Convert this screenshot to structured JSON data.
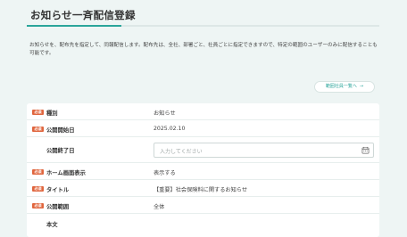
{
  "page": {
    "title": "お知らせ一斉配信登録",
    "description": "お知らせを、配布先を指定して、同報配信します。配布先は、全社、部署ごと、社員ごとに指定できますので、特定の範囲のユーザーのみに配信することも可能です。",
    "member_button": "範囲社員一覧へ",
    "member_button_arrow": "→"
  },
  "form": {
    "required_badge": "必須",
    "rows": [
      {
        "label": "種別",
        "value": "お知らせ",
        "required": true
      },
      {
        "label": "公開開始日",
        "value": "2025.02.10",
        "required": true
      },
      {
        "label": "公開終了日",
        "placeholder": "入力してください",
        "required": false
      },
      {
        "label": "ホーム画面表示",
        "value": "表示する",
        "required": true
      },
      {
        "label": "タイトル",
        "value": "【重要】社会保険料に関するお知らせ",
        "required": true
      },
      {
        "label": "公開範囲",
        "value": "全体",
        "required": true
      },
      {
        "label": "本文",
        "value": "",
        "required": false
      }
    ]
  },
  "colors": {
    "accent": "#2ba59b",
    "required": "#e0663e",
    "background": "#eef5f4"
  }
}
